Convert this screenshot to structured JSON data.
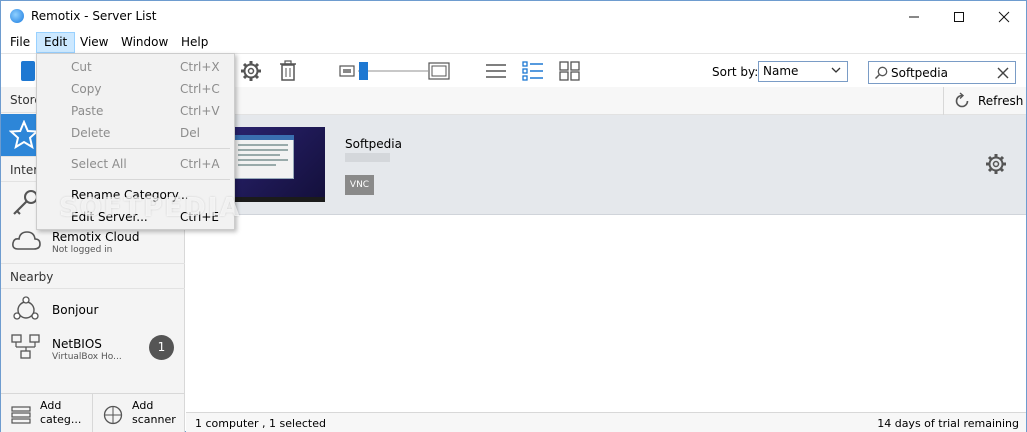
{
  "window": {
    "title": "Remotix - Server List"
  },
  "menubar": {
    "items": [
      "File",
      "Edit",
      "View",
      "Window",
      "Help"
    ]
  },
  "edit_menu": {
    "items": [
      {
        "label": "Cut",
        "shortcut": "Ctrl+X",
        "enabled": false
      },
      {
        "label": "Copy",
        "shortcut": "Ctrl+C",
        "enabled": false
      },
      {
        "label": "Paste",
        "shortcut": "Ctrl+V",
        "enabled": false
      },
      {
        "label": "Delete",
        "shortcut": "Del",
        "enabled": false
      },
      {
        "label": "Select All",
        "shortcut": "Ctrl+A",
        "enabled": false
      },
      {
        "label": "Rename Category...",
        "shortcut": "",
        "enabled": true
      },
      {
        "label": "Edit Server...",
        "shortcut": "Ctrl+E",
        "enabled": true
      }
    ]
  },
  "toolbar": {
    "sort_label": "Sort by:",
    "sort_value": "Name",
    "search_value": "Softpedia"
  },
  "sidebar": {
    "stored_label": "Store",
    "internet_label": "Inter",
    "cloud": {
      "label": "Remotix Cloud",
      "sub": "Not logged in"
    },
    "nearby_label": "Nearby",
    "bonjour": {
      "label": "Bonjour"
    },
    "netbios": {
      "label": "NetBIOS",
      "sub": "VirtualBox Ho...",
      "badge": "1"
    },
    "add_category": "Add\ncateg...",
    "add_scanner": "Add\nscanner"
  },
  "content": {
    "refresh_label": "Refresh",
    "server": {
      "name": "Softpedia",
      "tag": "VNC"
    }
  },
  "status": {
    "left": "1 computer , 1 selected",
    "right": "14 days of trial remaining"
  },
  "watermark": "SOFTPEDIA"
}
